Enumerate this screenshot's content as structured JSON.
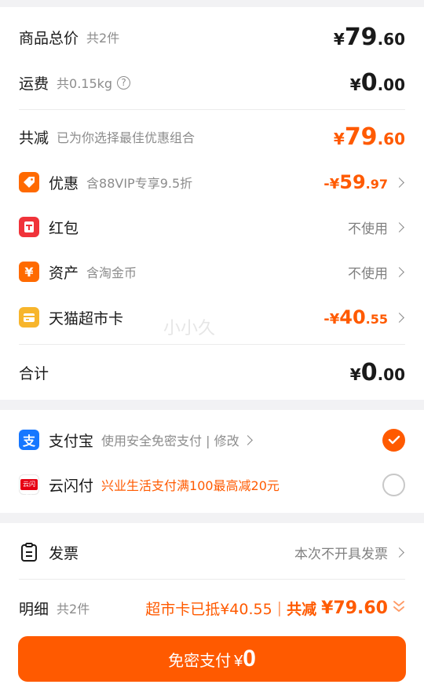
{
  "summary": {
    "goods": {
      "label": "商品总价",
      "sub": "共2件",
      "yen": "¥",
      "int": "79",
      "dec": ".60"
    },
    "shipping": {
      "label": "运费",
      "sub": "共0.15kg",
      "help_icon": "?",
      "yen": "¥",
      "int": "0",
      "dec": ".00"
    },
    "reduction": {
      "label": "共减",
      "sub": "已为你选择最佳优惠组合",
      "yen": "¥",
      "int": "79",
      "dec": ".60"
    },
    "items": [
      {
        "icon": "tag-icon",
        "label": "优惠",
        "sub": "含88VIP专享9.5折",
        "value_prefix": "-¥",
        "value_int": "59",
        "value_dec": ".97"
      },
      {
        "icon": "red-packet-icon",
        "label": "红包",
        "value_text": "不使用"
      },
      {
        "icon": "yen-coin-icon",
        "label": "资产",
        "sub": "含淘金币",
        "value_text": "不使用"
      },
      {
        "icon": "supermarket-card-icon",
        "label": "天猫超市卡",
        "value_prefix": "-¥",
        "value_int": "40",
        "value_dec": ".55"
      }
    ],
    "total": {
      "label": "合计",
      "yen": "¥",
      "int": "0",
      "dec": ".00"
    },
    "watermark": "小小久"
  },
  "payment": {
    "methods": [
      {
        "icon": "alipay-icon",
        "name": "支付宝",
        "desc": "使用安全免密支付 | 修改",
        "selected": true
      },
      {
        "icon": "unionpay-cloud-icon",
        "icon_text": "云闪付",
        "name": "云闪付",
        "desc": "兴业生活支付满100最高减20元",
        "selected": false
      }
    ]
  },
  "invoice": {
    "icon": "clipboard-icon",
    "label": "发票",
    "value": "本次不开具发票"
  },
  "detail": {
    "label": "明细",
    "sub": "共2件",
    "card_note": "超市卡已抵¥40.55",
    "sep": "|",
    "total_label": "共减",
    "total_value": "¥79.60"
  },
  "pay_button": {
    "label": "免密支付",
    "yen": "¥",
    "amount": "0"
  },
  "colors": {
    "accent": "#ff5a00",
    "alipay": "#1677ff",
    "redpacket": "#f0333a",
    "asset": "#ff6a00",
    "card": "#f7b52c"
  }
}
